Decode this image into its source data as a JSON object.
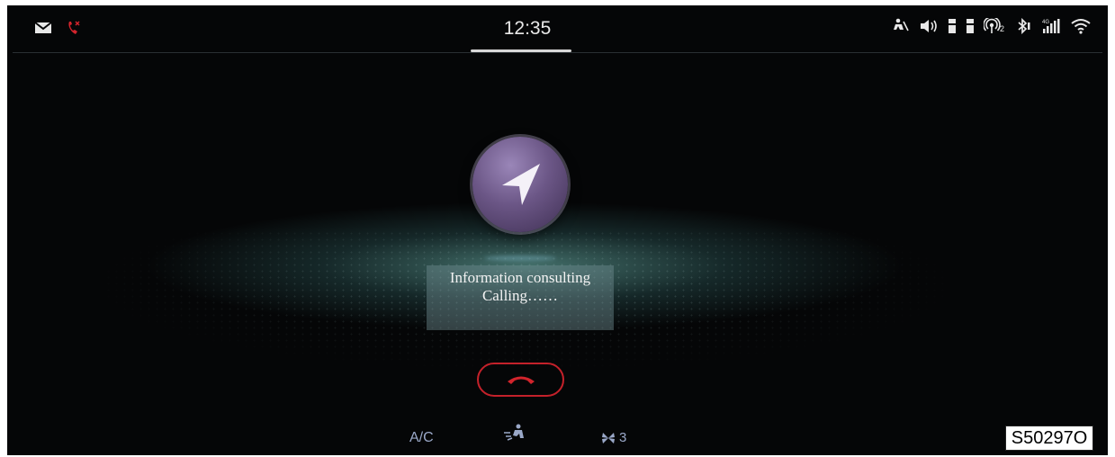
{
  "status_bar": {
    "time": "12:35",
    "left_icons": [
      "mail-icon",
      "missed-call-icon"
    ],
    "right_icons": [
      "seatbelt-icon",
      "volume-icon",
      "usb-icon-1",
      "usb-icon-2",
      "hotspot-icon",
      "bluetooth-icon",
      "signal-icon",
      "wifi-icon"
    ],
    "hotspot_sub": "2",
    "signal_sub": "4G"
  },
  "call": {
    "contact": "Information consulting",
    "status": "Calling……",
    "hangup_icon": "hang-up-icon"
  },
  "climate": {
    "ac_label": "A/C",
    "fan_speed": "3"
  },
  "reference_code": "S50297O",
  "colors": {
    "background": "#050607",
    "accent_red": "#c4212a",
    "orb_purple": "#6b5686",
    "glow_teal": "#78c8be",
    "climate_text": "#9aa8c8"
  }
}
